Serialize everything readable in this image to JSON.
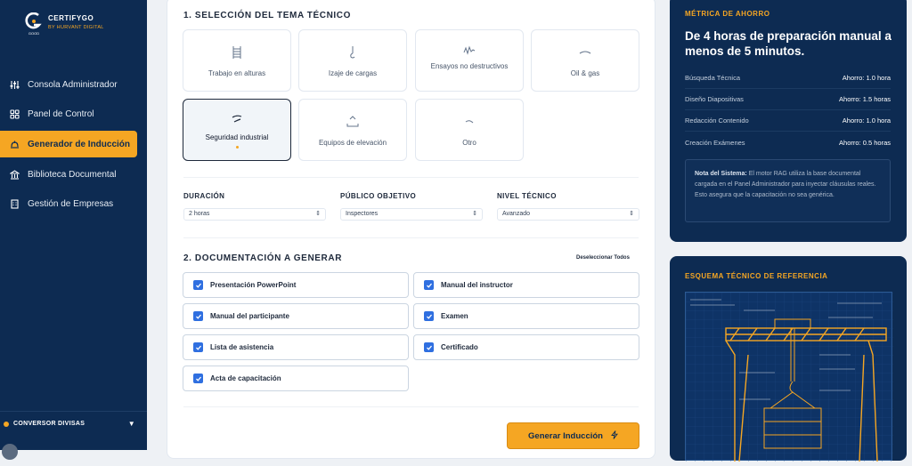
{
  "brand": {
    "name": "CERTIFYGO",
    "sub": "BY HURVANT DIGITAL",
    "logo_text": "GOOD"
  },
  "sidebar": {
    "items": [
      {
        "label": "Consola Administrador",
        "icon": "sliders-icon"
      },
      {
        "label": "Panel de Control",
        "icon": "grid-icon"
      },
      {
        "label": "Generador de Inducción",
        "icon": "hard-hat-icon"
      },
      {
        "label": "Biblioteca Documental",
        "icon": "library-icon"
      },
      {
        "label": "Gestión de Empresas",
        "icon": "building-icon"
      }
    ],
    "active_index": 2,
    "converter": {
      "label": "CONVERSOR DIVISAS",
      "icon": "chevron-down-icon"
    }
  },
  "topics": {
    "title": "1. SELECCIÓN DEL TEMA TÉCNICO",
    "items": [
      {
        "label": "Trabajo en alturas",
        "icon": "ladder-icon"
      },
      {
        "label": "Izaje de cargas",
        "icon": "hook-icon"
      },
      {
        "label": "Ensayos no destructivos",
        "icon": "wave-icon"
      },
      {
        "label": "Oil & gas",
        "icon": "drop-icon"
      },
      {
        "label": "Seguridad industrial",
        "icon": "shield-icon"
      },
      {
        "label": "Equipos de elevación",
        "icon": "lift-icon"
      },
      {
        "label": "Otro",
        "icon": "dots-icon"
      }
    ],
    "selected_index": 4
  },
  "fields": {
    "duracion": {
      "label": "DURACIÓN",
      "value": "2 horas"
    },
    "publico": {
      "label": "PÚBLICO OBJETIVO",
      "value": "Inspectores"
    },
    "nivel": {
      "label": "NIVEL TÉCNICO",
      "value": "Avanzado"
    }
  },
  "docs": {
    "title": "2. DOCUMENTACIÓN A GENERAR",
    "deselect_label": "Deseleccionar Todos",
    "items": [
      {
        "label": "Presentación PowerPoint",
        "checked": true
      },
      {
        "label": "Manual del instructor",
        "checked": true
      },
      {
        "label": "Manual del participante",
        "checked": true
      },
      {
        "label": "Examen",
        "checked": true
      },
      {
        "label": "Lista de asistencia",
        "checked": true
      },
      {
        "label": "Certificado",
        "checked": true
      },
      {
        "label": "Acta de capacitación",
        "checked": true
      }
    ]
  },
  "generate": {
    "label": "Generar Inducción",
    "icon": "bolt-icon"
  },
  "savings": {
    "title": "MÉTRICA DE AHORRO",
    "headline": "De 4 horas de preparación manual a menos de 5 minutos.",
    "rows": [
      {
        "label": "Búsqueda Técnica",
        "value": "Ahorro: 1.0 hora"
      },
      {
        "label": "Diseño Diapositivas",
        "value": "Ahorro: 1.5 horas"
      },
      {
        "label": "Redacción Contenido",
        "value": "Ahorro: 1.0 hora"
      },
      {
        "label": "Creación Exámenes",
        "value": "Ahorro: 0.5 horas"
      }
    ],
    "note_label": "Nota del Sistema:",
    "note_text": " El motor RAG utiliza la base documental cargada en el Panel Administrador para inyectar cláusulas reales. Esto asegura que la capacitación no sea genérica."
  },
  "schematic": {
    "title": "ESQUEMA TÉCNICO DE REFERENCIA"
  },
  "colors": {
    "navy": "#0d2b52",
    "accent": "#f5a623",
    "check": "#2f6fe0"
  }
}
